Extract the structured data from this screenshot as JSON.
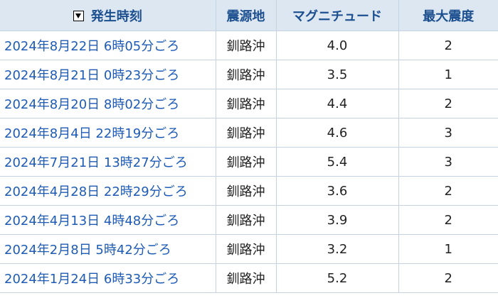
{
  "table": {
    "headers": {
      "time": "発生時刻",
      "epicenter": "震源地",
      "magnitude": "マグニチュード",
      "intensity": "最大震度"
    },
    "sort_icon": "sort-down-icon",
    "rows": [
      {
        "time": "2024年8月22日 6時05分ごろ",
        "epicenter": "釧路沖",
        "magnitude": "4.0",
        "intensity": "2"
      },
      {
        "time": "2024年8月21日 0時23分ごろ",
        "epicenter": "釧路沖",
        "magnitude": "3.5",
        "intensity": "1"
      },
      {
        "time": "2024年8月20日 8時02分ごろ",
        "epicenter": "釧路沖",
        "magnitude": "4.4",
        "intensity": "2"
      },
      {
        "time": "2024年8月4日 22時19分ごろ",
        "epicenter": "釧路沖",
        "magnitude": "4.6",
        "intensity": "3"
      },
      {
        "time": "2024年7月21日 13時27分ごろ",
        "epicenter": "釧路沖",
        "magnitude": "5.4",
        "intensity": "3"
      },
      {
        "time": "2024年4月28日 22時29分ごろ",
        "epicenter": "釧路沖",
        "magnitude": "3.6",
        "intensity": "2"
      },
      {
        "time": "2024年4月13日 4時48分ごろ",
        "epicenter": "釧路沖",
        "magnitude": "3.9",
        "intensity": "2"
      },
      {
        "time": "2024年2月8日 5時42分ごろ",
        "epicenter": "釧路沖",
        "magnitude": "3.2",
        "intensity": "1"
      },
      {
        "time": "2024年1月24日 6時33分ごろ",
        "epicenter": "釧路沖",
        "magnitude": "5.2",
        "intensity": "2"
      }
    ]
  },
  "colors": {
    "header_bg": "#dde7f1",
    "header_text": "#1b4f8f",
    "link": "#1e5bb5",
    "grid": "#c5d2e0"
  }
}
